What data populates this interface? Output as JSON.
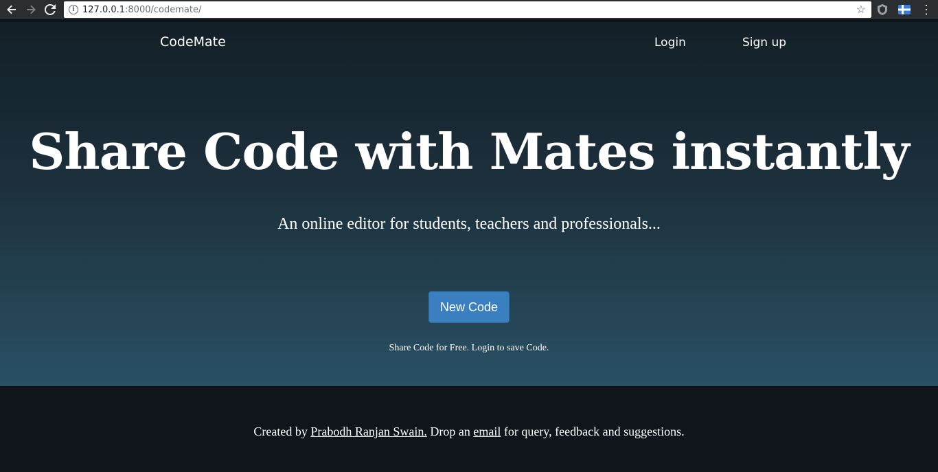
{
  "browser": {
    "back_icon": "arrow-left-icon",
    "forward_icon": "arrow-right-icon",
    "reload_icon": "reload-icon",
    "url_host": "127.0.0.1",
    "url_path": ":8000/codemate/",
    "star_icon": "star-icon",
    "menu_icon": "kebab-menu-icon"
  },
  "navbar": {
    "brand": "CodeMate",
    "login": "Login",
    "signup": "Sign up"
  },
  "hero": {
    "headline": "Share Code with Mates instantly",
    "subline": "An online editor for students, teachers and professionals...",
    "button_label": "New Code",
    "hint": "Share Code for Free. Login to save Code."
  },
  "footer": {
    "prefix": "Created by ",
    "author_link": "Prabodh Ranjan Swain.",
    "middle": " Drop an ",
    "email_link": "email",
    "suffix": " for query, feedback and suggestions."
  },
  "colors": {
    "button": "#3a7fc0",
    "footer_bg": "#0f151a",
    "hero_top": "#131f27",
    "hero_bottom": "#2a5064"
  }
}
